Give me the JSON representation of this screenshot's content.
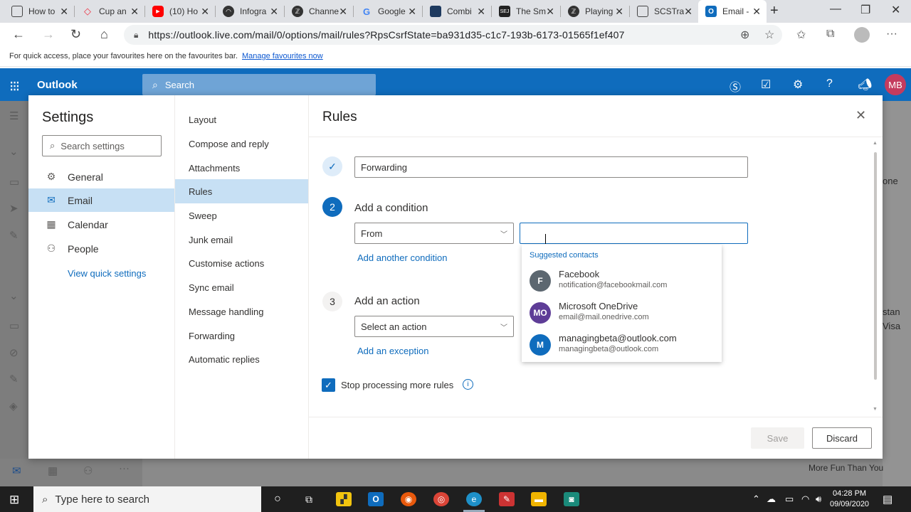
{
  "browser": {
    "tabs": [
      {
        "label": "How to",
        "favicon": "doc",
        "color": "#444"
      },
      {
        "label": "Cup an",
        "favicon": "diamond",
        "color": "#e34"
      },
      {
        "label": "(10) Ho",
        "favicon": "youtube",
        "color": "#f00"
      },
      {
        "label": "Infogra",
        "favicon": "site",
        "color": "#333"
      },
      {
        "label": "Channe",
        "favicon": "site",
        "color": "#333"
      },
      {
        "label": "Google",
        "favicon": "google",
        "color": "#4285f4"
      },
      {
        "label": "Combi",
        "favicon": "site",
        "color": "#1e3a5f"
      },
      {
        "label": "The Sm",
        "favicon": "sej",
        "color": "#222"
      },
      {
        "label": "Playing",
        "favicon": "site",
        "color": "#333"
      },
      {
        "label": "SCSTra",
        "favicon": "doc",
        "color": "#444"
      },
      {
        "label": "Email -",
        "favicon": "outlook",
        "color": "#0f6cbd"
      }
    ],
    "url": "https://outlook.live.com/mail/0/options/mail/rules?RpsCsrfState=ba931d35-c1c7-193b-6173-01565f1ef407",
    "favbar_text": "For quick access, place your favourites here on the favourites bar.",
    "favbar_link": "Manage favourites now"
  },
  "outlook": {
    "app_name": "Outlook",
    "search_placeholder": "Search",
    "user_initials": "MB"
  },
  "background_snippets": [
    "one",
    "stan",
    "Visa",
    "More Fun Than You"
  ],
  "settings": {
    "title": "Settings",
    "search_placeholder": "Search settings",
    "categories": [
      {
        "label": "General",
        "icon": "gear-icon"
      },
      {
        "label": "Email",
        "icon": "mail-icon"
      },
      {
        "label": "Calendar",
        "icon": "calendar-icon"
      },
      {
        "label": "People",
        "icon": "people-icon"
      }
    ],
    "view_quick_settings": "View quick settings",
    "subcategories": [
      "Layout",
      "Compose and reply",
      "Attachments",
      "Rules",
      "Sweep",
      "Junk email",
      "Customise actions",
      "Sync email",
      "Message handling",
      "Forwarding",
      "Automatic replies"
    ]
  },
  "rules": {
    "title": "Rules",
    "rule_name_value": "Forwarding",
    "step2_number": "2",
    "step2_heading": "Add a condition",
    "condition_value": "From",
    "add_condition": "Add another condition",
    "step3_number": "3",
    "step3_heading": "Add an action",
    "action_placeholder": "Select an action",
    "add_exception": "Add an exception",
    "stop_processing": "Stop processing more rules",
    "save": "Save",
    "discard": "Discard"
  },
  "suggestions": {
    "title": "Suggested contacts",
    "contacts": [
      {
        "initials": "F",
        "name": "Facebook",
        "email": "notification@facebookmail.com",
        "color": "#5c6770"
      },
      {
        "initials": "MO",
        "name": "Microsoft OneDrive",
        "email": "email@mail.onedrive.com",
        "color": "#5e3d97"
      },
      {
        "initials": "M",
        "name": "managingbeta@outlook.com",
        "email": "managingbeta@outlook.com",
        "color": "#0f6cbd"
      }
    ]
  },
  "taskbar": {
    "search_placeholder": "Type here to search",
    "time": "04:28 PM",
    "date": "09/09/2020"
  }
}
